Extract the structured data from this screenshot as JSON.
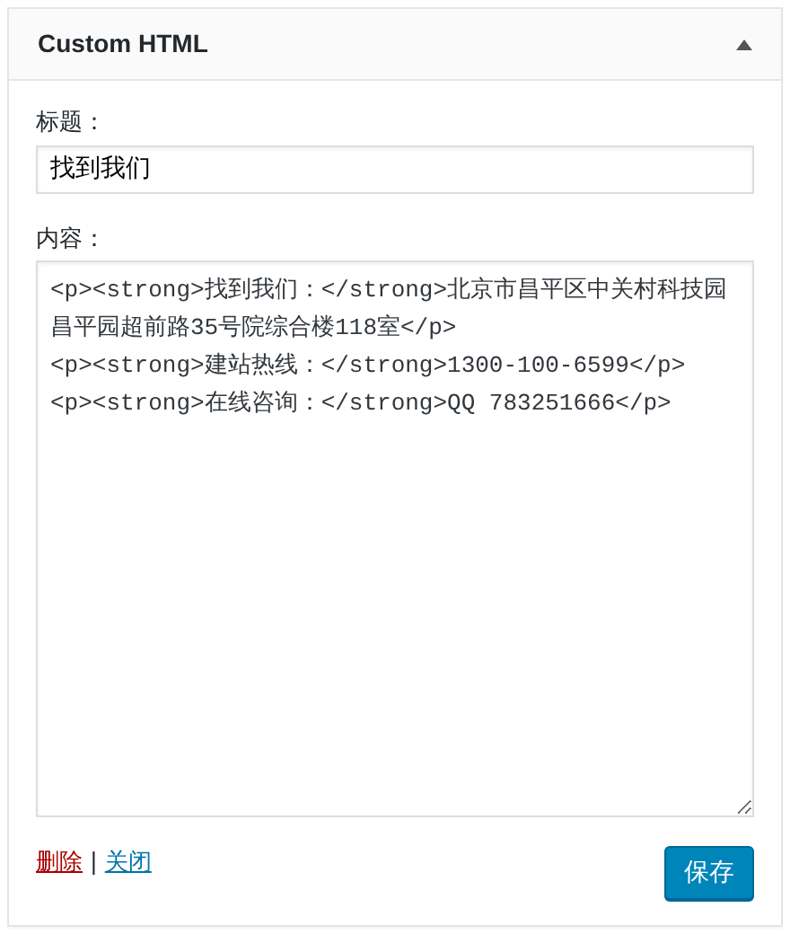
{
  "widget": {
    "title": "Custom HTML",
    "expanded": true
  },
  "title_field": {
    "label": "标题：",
    "value": "找到我们"
  },
  "content_field": {
    "label": "内容：",
    "value": "<p><strong>找到我们：</strong>北京市昌平区中关村科技园昌平园超前路35号院综合楼118室</p>\n<p><strong>建站热线：</strong>1300-100-6599</p>\n<p><strong>在线咨询：</strong>QQ 783251666</p>"
  },
  "footer": {
    "delete_link": "删除",
    "separator": "|",
    "close_link": "关闭",
    "save_button": "保存"
  }
}
